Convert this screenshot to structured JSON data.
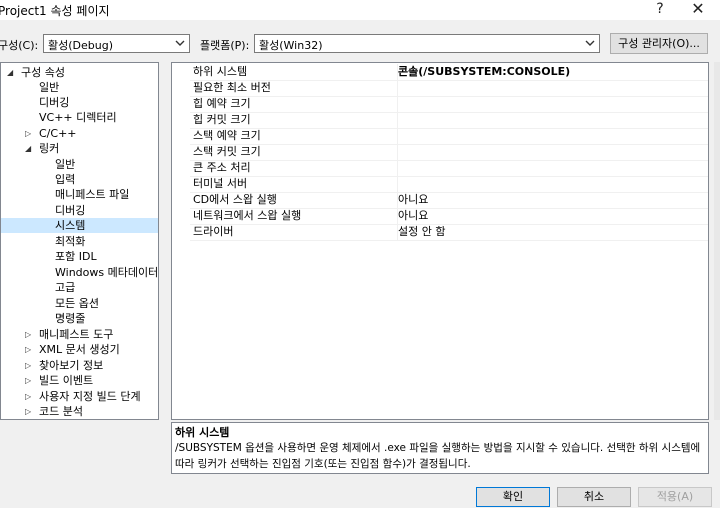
{
  "window": {
    "title": "Project1 속성 페이지",
    "help": "?",
    "close": "✕"
  },
  "toolbar": {
    "config_label": "구성(C):",
    "config_value": "활성(Debug)",
    "platform_label": "플랫폼(P):",
    "platform_value": "활성(Win32)",
    "config_manager": "구성 관리자(O)..."
  },
  "tree": {
    "root": "구성 속성",
    "items": [
      "일반",
      "디버깅",
      "VC++ 디렉터리",
      "C/C++",
      "링커",
      "일반",
      "입력",
      "매니페스트 파일",
      "디버깅",
      "시스템",
      "최적화",
      "포함 IDL",
      "Windows 메타데이터",
      "고급",
      "모든 옵션",
      "명령줄",
      "매니페스트 도구",
      "XML 문서 생성기",
      "찾아보기 정보",
      "빌드 이벤트",
      "사용자 지정 빌드 단계",
      "코드 분석"
    ],
    "selected": "시스템"
  },
  "properties": [
    {
      "name": "하위 시스템",
      "value": "콘솔(/SUBSYSTEM:CONSOLE)"
    },
    {
      "name": "필요한 최소 버전",
      "value": ""
    },
    {
      "name": "힙 예약 크기",
      "value": ""
    },
    {
      "name": "힙 커밋 크기",
      "value": ""
    },
    {
      "name": "스택 예약 크기",
      "value": ""
    },
    {
      "name": "스택 커밋 크기",
      "value": ""
    },
    {
      "name": "큰 주소 처리",
      "value": ""
    },
    {
      "name": "터미널 서버",
      "value": ""
    },
    {
      "name": "CD에서 스왑 실행",
      "value": "아니요"
    },
    {
      "name": "네트워크에서 스왑 실행",
      "value": "아니요"
    },
    {
      "name": "드라이버",
      "value": "설정 안 함"
    }
  ],
  "description": {
    "title": "하위 시스템",
    "text": "/SUBSYSTEM 옵션을 사용하면 운영 체제에서 .exe 파일을 실행하는 방법을 지시할 수 있습니다. 선택한 하위 시스템에 따라 링커가 선택하는 진입점 기호(또는 진입점 함수)가 결정됩니다."
  },
  "buttons": {
    "ok": "확인",
    "cancel": "취소",
    "apply": "적용(A)"
  },
  "colors": {
    "selection": "#cce8ff",
    "window_bg": "#f0f0f0",
    "disabled_text": "#a0a0a0"
  }
}
